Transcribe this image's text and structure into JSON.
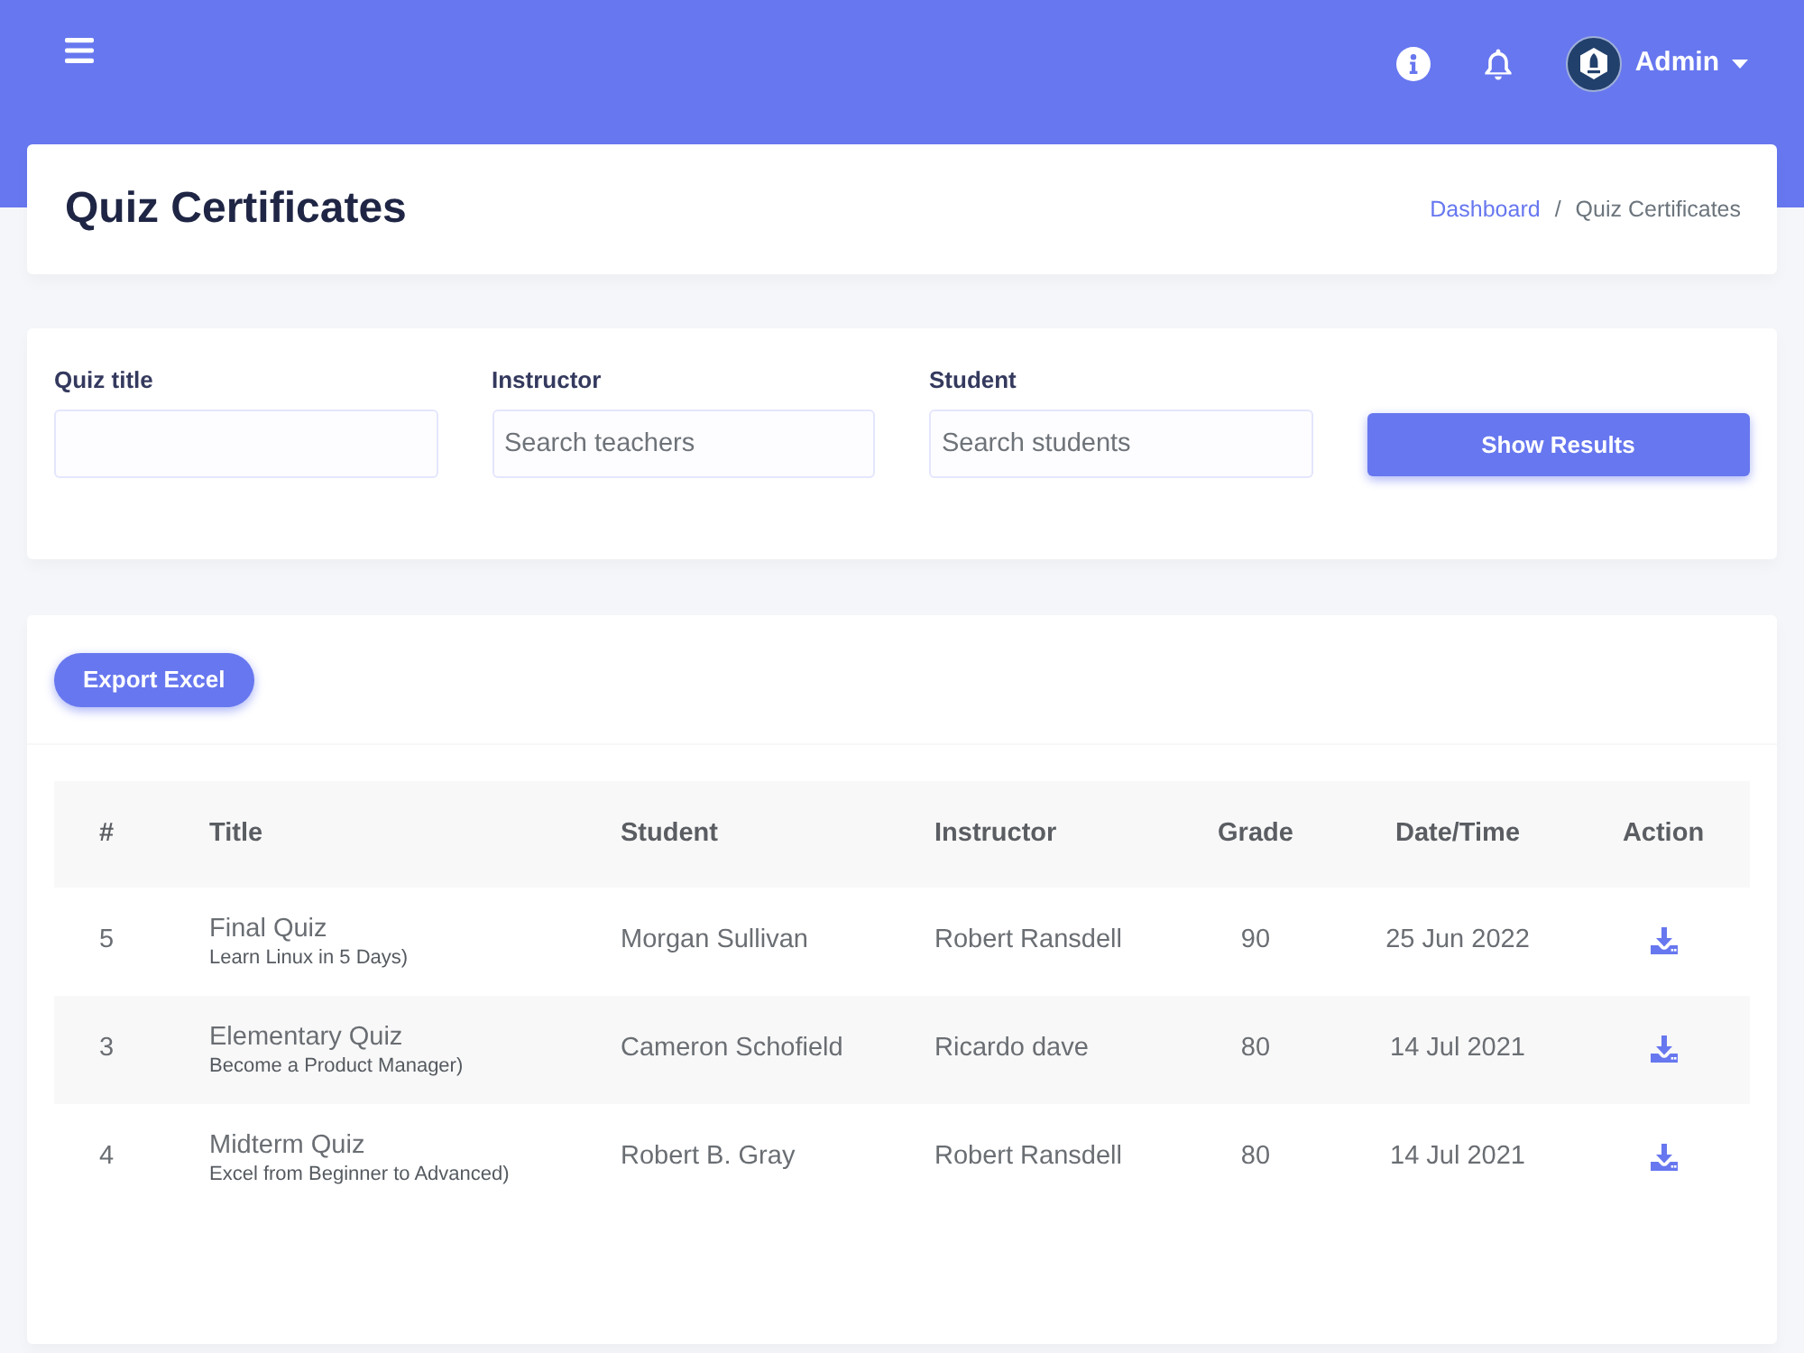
{
  "top_bar": {
    "user_name": "Admin"
  },
  "page_header": {
    "title": "Quiz Certificates",
    "separator": "/",
    "breadcrumb": [
      {
        "label": "Dashboard",
        "active": false
      },
      {
        "label": "Quiz Certificates",
        "active": true
      }
    ]
  },
  "filters": {
    "fields": [
      {
        "label": "Quiz title"
      },
      {
        "label": "Instructor",
        "placeholder": "Search teachers"
      },
      {
        "label": "Student",
        "placeholder": "Search students"
      }
    ],
    "button": "Show Results"
  },
  "results": {
    "export_button": "Export Excel",
    "table": {
      "columns": [
        "#",
        "Title",
        "Student",
        "Instructor",
        "Grade",
        "Date/Time",
        "Action"
      ],
      "rows": [
        {
          "number": "5",
          "title": "Final Quiz",
          "course": "Learn Linux in 5 Days)",
          "student": "Morgan Sullivan",
          "instructor": "Robert Ransdell",
          "grade": "90",
          "date": "25 Jun 2022"
        },
        {
          "number": "3",
          "title": "Elementary Quiz",
          "course": "Become a Product Manager)",
          "student": "Cameron Schofield",
          "instructor": "Ricardo dave",
          "grade": "80",
          "date": "14 Jul 2021"
        },
        {
          "number": "4",
          "title": "Midterm Quiz",
          "course": "Excel from Beginner to Advanced)",
          "student": "Robert B. Gray",
          "instructor": "Robert Ransdell",
          "grade": "80",
          "date": "14 Jul 2021"
        }
      ]
    }
  }
}
